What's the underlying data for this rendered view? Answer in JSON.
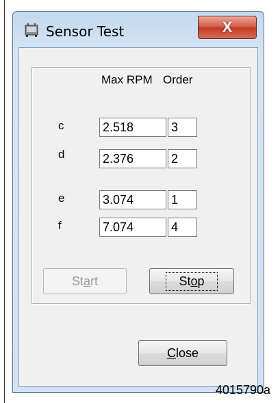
{
  "window": {
    "title": "Sensor Test",
    "close_glyph": "X"
  },
  "table": {
    "col_max_rpm": "Max RPM",
    "col_order": "Order",
    "rows": [
      {
        "label": "c",
        "max_rpm": "2.518",
        "order": "3"
      },
      {
        "label": "d",
        "max_rpm": "2.376",
        "order": "2"
      },
      {
        "label": "e",
        "max_rpm": "3.074",
        "order": "1"
      },
      {
        "label": "f",
        "max_rpm": "7.074",
        "order": "4"
      }
    ]
  },
  "buttons": {
    "start_label": "Start",
    "start_mnemonic": "a",
    "stop_label": "Stop",
    "stop_mnemonic": "o",
    "close_label": "Close",
    "close_mnemonic": "C"
  },
  "figure_code": "4015790a",
  "colors": {
    "title_bar": "#c2d9ef",
    "close_button": "#c13a26",
    "client_bg": "#f0f0f0"
  }
}
